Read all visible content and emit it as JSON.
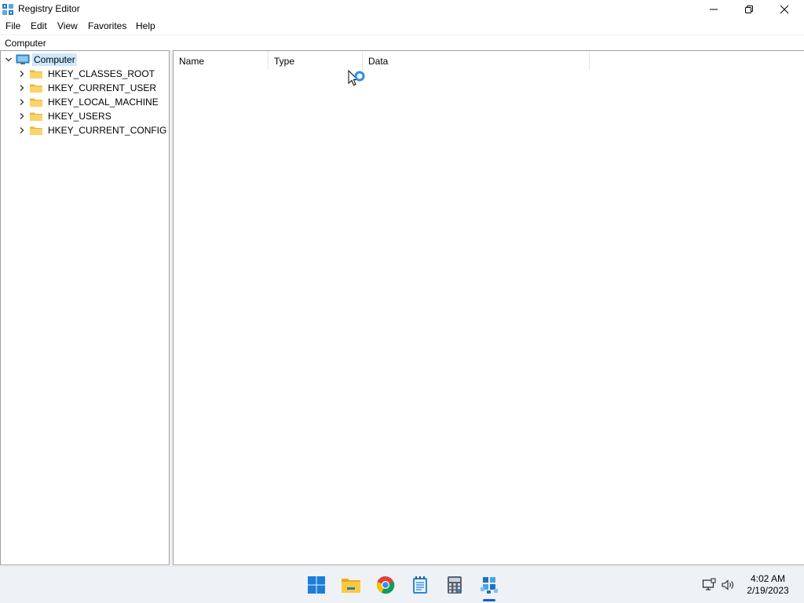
{
  "window": {
    "title": "Registry Editor",
    "controls": {
      "minimize": "minimize",
      "maximize": "restore",
      "close": "close"
    }
  },
  "menu": [
    "File",
    "Edit",
    "View",
    "Favorites",
    "Help"
  ],
  "address": "Computer",
  "tree": {
    "root": "Computer",
    "children": [
      "HKEY_CLASSES_ROOT",
      "HKEY_CURRENT_USER",
      "HKEY_LOCAL_MACHINE",
      "HKEY_USERS",
      "HKEY_CURRENT_CONFIG"
    ]
  },
  "list": {
    "columns": [
      "Name",
      "Type",
      "Data"
    ],
    "rows": []
  },
  "taskbar": {
    "apps": [
      "start-icon",
      "file-explorer-icon",
      "chrome-icon",
      "notepad-icon",
      "calculator-icon",
      "registry-editor-icon"
    ],
    "active": "registry-editor-icon",
    "clock": {
      "time": "4:02 AM",
      "date": "2/19/2023"
    }
  },
  "colors": {
    "selection": "#cce8ff",
    "accent": "#0a64c8",
    "taskbar": "#eef1f6"
  }
}
